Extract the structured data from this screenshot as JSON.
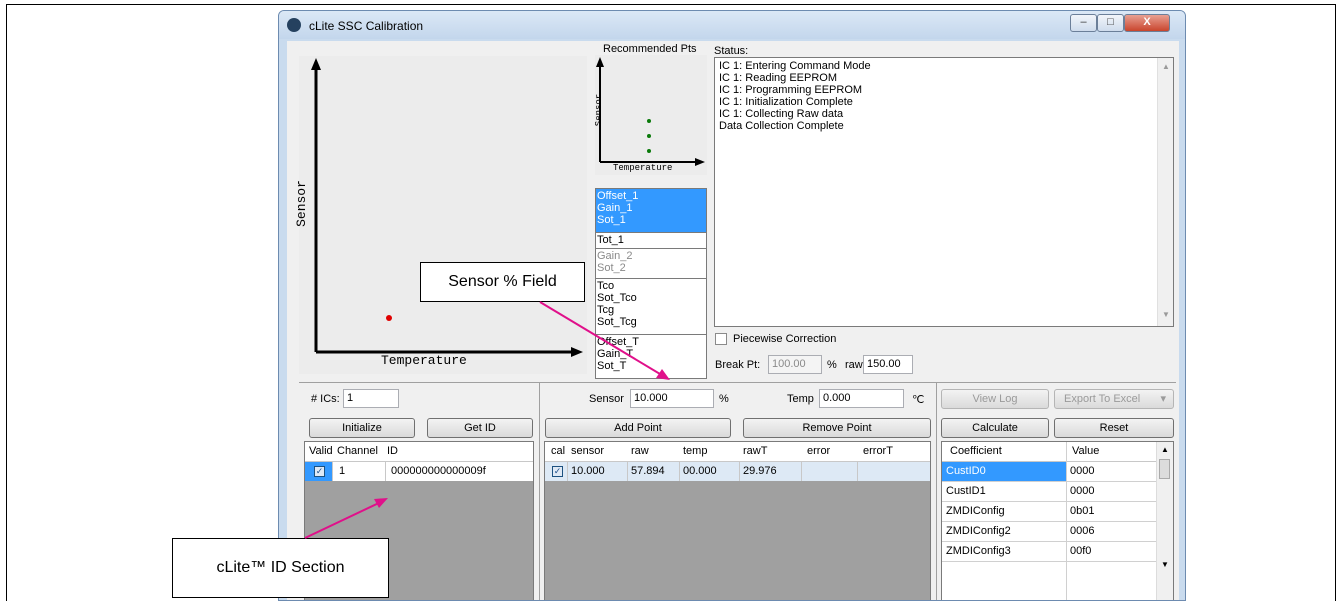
{
  "window": {
    "title": "cLite SSC Calibration",
    "controls": [
      "–",
      "□",
      "X"
    ]
  },
  "main_graph": {
    "x_label": "Temperature",
    "y_label": "Sensor"
  },
  "recommended": {
    "title": "Recommended Pts",
    "x_label": "Temperature",
    "y_label": "Sensor"
  },
  "coeff_list": {
    "group1": [
      "Offset_1",
      "Gain_1",
      "Sot_1"
    ],
    "group2": [
      "Tot_1"
    ],
    "group3": [
      "Gain_2",
      "Sot_2"
    ],
    "group4": [
      "Tco",
      "Sot_Tco",
      "Tcg",
      "Sot_Tcg"
    ],
    "group5": [
      "Offset_T",
      "Gain_T",
      "Sot_T"
    ]
  },
  "status": {
    "label": "Status:",
    "lines": [
      "IC 1: Entering Command Mode",
      "IC 1: Reading EEPROM",
      "IC 1: Programming EEPROM",
      "IC 1: Initialization Complete",
      "IC 1: Collecting Raw data",
      "Data Collection Complete"
    ]
  },
  "piecewise": {
    "label": "Piecewise Correction",
    "break_label": "Break Pt:",
    "break_value": "100.00",
    "percent": "%",
    "raw_label": "raw",
    "raw_value": "150.00"
  },
  "controls": {
    "ics_label": "# ICs:",
    "ics_value": "1",
    "sensor_label": "Sensor",
    "sensor_value": "10.000",
    "sensor_unit": "%",
    "temp_label": "Temp",
    "temp_value": "0.000",
    "temp_unit": "℃",
    "view_log": "View Log",
    "export": "Export To Excel",
    "export_arrow": "▾",
    "initialize": "Initialize",
    "get_id": "Get ID",
    "add_point": "Add Point",
    "remove_point": "Remove Point",
    "calculate": "Calculate",
    "reset": "Reset"
  },
  "id_table": {
    "headers": [
      "Valid",
      "Channel",
      "ID"
    ],
    "rows": [
      {
        "valid": "✓",
        "channel": "1",
        "id": "000000000000009f"
      }
    ]
  },
  "points_table": {
    "headers": [
      "cal",
      "sensor",
      "raw",
      "temp",
      "rawT",
      "error",
      "errorT"
    ],
    "rows": [
      {
        "cal": "✓",
        "sensor": "10.000",
        "raw": "57.894",
        "temp": "00.000",
        "rawT": "29.976",
        "error": "",
        "errorT": ""
      }
    ]
  },
  "coef_table": {
    "headers": [
      "Coefficient",
      "Value"
    ],
    "rows": [
      {
        "name": "CustID0",
        "value": "0000"
      },
      {
        "name": "CustID1",
        "value": "0000"
      },
      {
        "name": "ZMDIConfig",
        "value": "0b01"
      },
      {
        "name": "ZMDIConfig2",
        "value": "0006"
      },
      {
        "name": "ZMDIConfig3",
        "value": "00f0"
      }
    ]
  },
  "callouts": {
    "sensor_field": "Sensor % Field",
    "id_section": "cLite™ ID Section"
  },
  "colors": {
    "selection": "#3399ff",
    "arrow": "#e0108a",
    "point_red": "#e00000",
    "point_green": "#0a7a0a"
  }
}
